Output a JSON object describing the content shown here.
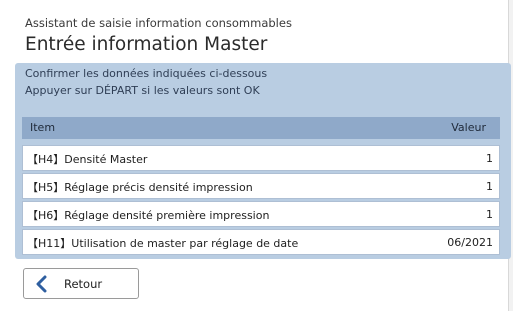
{
  "header": {
    "subtitle": "Assistant de saisie information consommables",
    "title": "Entrée information Master"
  },
  "panel": {
    "message_line1": "Confirmer les données indiquées ci-dessous",
    "message_line2": "Appuyer sur DÉPART si les valeurs sont OK",
    "columns": {
      "item": "Item",
      "value": "Valeur"
    },
    "rows": [
      {
        "label": "【H4】Densité Master",
        "value": "1"
      },
      {
        "label": "【H5】Réglage précis densité impression",
        "value": "1"
      },
      {
        "label": "【H6】Réglage densité première impression",
        "value": "1"
      },
      {
        "label": "【H11】Utilisation de master par réglage de date",
        "value": "06/2021"
      }
    ]
  },
  "footer": {
    "back_label": "Retour",
    "back_icon": "chevron-left-icon"
  },
  "colors": {
    "panel": "#b9cde2",
    "table_header": "#8fa9c9",
    "accent": "#2f5fa0"
  }
}
